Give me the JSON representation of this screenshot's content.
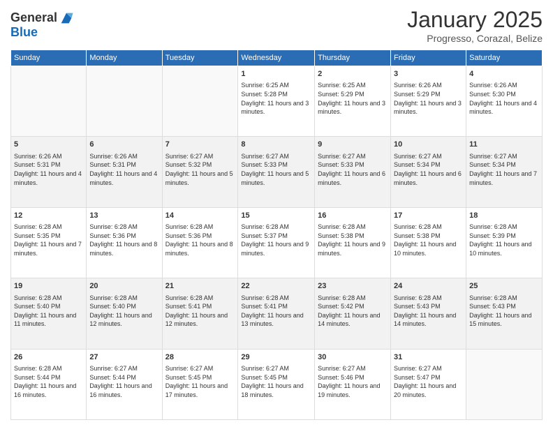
{
  "header": {
    "logo_general": "General",
    "logo_blue": "Blue",
    "month": "January 2025",
    "location": "Progresso, Corazal, Belize"
  },
  "weekdays": [
    "Sunday",
    "Monday",
    "Tuesday",
    "Wednesday",
    "Thursday",
    "Friday",
    "Saturday"
  ],
  "weeks": [
    [
      {
        "day": "",
        "info": ""
      },
      {
        "day": "",
        "info": ""
      },
      {
        "day": "",
        "info": ""
      },
      {
        "day": "1",
        "info": "Sunrise: 6:25 AM\nSunset: 5:28 PM\nDaylight: 11 hours and 3 minutes."
      },
      {
        "day": "2",
        "info": "Sunrise: 6:25 AM\nSunset: 5:29 PM\nDaylight: 11 hours and 3 minutes."
      },
      {
        "day": "3",
        "info": "Sunrise: 6:26 AM\nSunset: 5:29 PM\nDaylight: 11 hours and 3 minutes."
      },
      {
        "day": "4",
        "info": "Sunrise: 6:26 AM\nSunset: 5:30 PM\nDaylight: 11 hours and 4 minutes."
      }
    ],
    [
      {
        "day": "5",
        "info": "Sunrise: 6:26 AM\nSunset: 5:31 PM\nDaylight: 11 hours and 4 minutes."
      },
      {
        "day": "6",
        "info": "Sunrise: 6:26 AM\nSunset: 5:31 PM\nDaylight: 11 hours and 4 minutes."
      },
      {
        "day": "7",
        "info": "Sunrise: 6:27 AM\nSunset: 5:32 PM\nDaylight: 11 hours and 5 minutes."
      },
      {
        "day": "8",
        "info": "Sunrise: 6:27 AM\nSunset: 5:33 PM\nDaylight: 11 hours and 5 minutes."
      },
      {
        "day": "9",
        "info": "Sunrise: 6:27 AM\nSunset: 5:33 PM\nDaylight: 11 hours and 6 minutes."
      },
      {
        "day": "10",
        "info": "Sunrise: 6:27 AM\nSunset: 5:34 PM\nDaylight: 11 hours and 6 minutes."
      },
      {
        "day": "11",
        "info": "Sunrise: 6:27 AM\nSunset: 5:34 PM\nDaylight: 11 hours and 7 minutes."
      }
    ],
    [
      {
        "day": "12",
        "info": "Sunrise: 6:28 AM\nSunset: 5:35 PM\nDaylight: 11 hours and 7 minutes."
      },
      {
        "day": "13",
        "info": "Sunrise: 6:28 AM\nSunset: 5:36 PM\nDaylight: 11 hours and 8 minutes."
      },
      {
        "day": "14",
        "info": "Sunrise: 6:28 AM\nSunset: 5:36 PM\nDaylight: 11 hours and 8 minutes."
      },
      {
        "day": "15",
        "info": "Sunrise: 6:28 AM\nSunset: 5:37 PM\nDaylight: 11 hours and 9 minutes."
      },
      {
        "day": "16",
        "info": "Sunrise: 6:28 AM\nSunset: 5:38 PM\nDaylight: 11 hours and 9 minutes."
      },
      {
        "day": "17",
        "info": "Sunrise: 6:28 AM\nSunset: 5:38 PM\nDaylight: 11 hours and 10 minutes."
      },
      {
        "day": "18",
        "info": "Sunrise: 6:28 AM\nSunset: 5:39 PM\nDaylight: 11 hours and 10 minutes."
      }
    ],
    [
      {
        "day": "19",
        "info": "Sunrise: 6:28 AM\nSunset: 5:40 PM\nDaylight: 11 hours and 11 minutes."
      },
      {
        "day": "20",
        "info": "Sunrise: 6:28 AM\nSunset: 5:40 PM\nDaylight: 11 hours and 12 minutes."
      },
      {
        "day": "21",
        "info": "Sunrise: 6:28 AM\nSunset: 5:41 PM\nDaylight: 11 hours and 12 minutes."
      },
      {
        "day": "22",
        "info": "Sunrise: 6:28 AM\nSunset: 5:41 PM\nDaylight: 11 hours and 13 minutes."
      },
      {
        "day": "23",
        "info": "Sunrise: 6:28 AM\nSunset: 5:42 PM\nDaylight: 11 hours and 14 minutes."
      },
      {
        "day": "24",
        "info": "Sunrise: 6:28 AM\nSunset: 5:43 PM\nDaylight: 11 hours and 14 minutes."
      },
      {
        "day": "25",
        "info": "Sunrise: 6:28 AM\nSunset: 5:43 PM\nDaylight: 11 hours and 15 minutes."
      }
    ],
    [
      {
        "day": "26",
        "info": "Sunrise: 6:28 AM\nSunset: 5:44 PM\nDaylight: 11 hours and 16 minutes."
      },
      {
        "day": "27",
        "info": "Sunrise: 6:27 AM\nSunset: 5:44 PM\nDaylight: 11 hours and 16 minutes."
      },
      {
        "day": "28",
        "info": "Sunrise: 6:27 AM\nSunset: 5:45 PM\nDaylight: 11 hours and 17 minutes."
      },
      {
        "day": "29",
        "info": "Sunrise: 6:27 AM\nSunset: 5:45 PM\nDaylight: 11 hours and 18 minutes."
      },
      {
        "day": "30",
        "info": "Sunrise: 6:27 AM\nSunset: 5:46 PM\nDaylight: 11 hours and 19 minutes."
      },
      {
        "day": "31",
        "info": "Sunrise: 6:27 AM\nSunset: 5:47 PM\nDaylight: 11 hours and 20 minutes."
      },
      {
        "day": "",
        "info": ""
      }
    ]
  ]
}
